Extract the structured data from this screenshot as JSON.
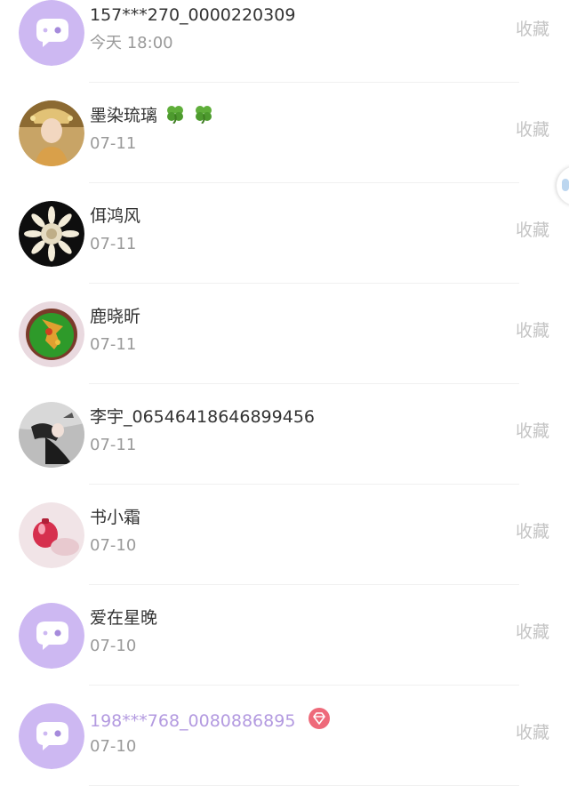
{
  "favorite_label": "收藏",
  "users": [
    {
      "name": "157***270_0000220309",
      "date": "今天 18:00",
      "avatar": "default-chat-avatar",
      "vip": false
    },
    {
      "name": "墨染琉璃",
      "date": "07-11",
      "avatar": "photo-avatar-costume",
      "vip": false,
      "clovers": 2
    },
    {
      "name": "佴鸿风",
      "date": "07-11",
      "avatar": "photo-avatar-flower-pattern",
      "vip": false
    },
    {
      "name": "鹿晓昕",
      "date": "07-11",
      "avatar": "photo-avatar-deer-art",
      "vip": false
    },
    {
      "name": "李宇_06546418646899456",
      "date": "07-11",
      "avatar": "photo-avatar-person-bw",
      "vip": false
    },
    {
      "name": "书小霜",
      "date": "07-10",
      "avatar": "photo-avatar-pink-drop",
      "vip": false
    },
    {
      "name": "爱在星晚",
      "date": "07-10",
      "avatar": "default-chat-avatar",
      "vip": false
    },
    {
      "name": "198***768_0080886895",
      "date": "07-10",
      "avatar": "default-chat-avatar",
      "vip": true
    }
  ],
  "colors": {
    "name": "#333333",
    "date": "#9a9a9a",
    "favorite": "#c4c4c4",
    "vip_name": "#b39ae0",
    "default_avatar_bg": "#cdb8f2",
    "vip_badge": "#ee6a7a"
  }
}
